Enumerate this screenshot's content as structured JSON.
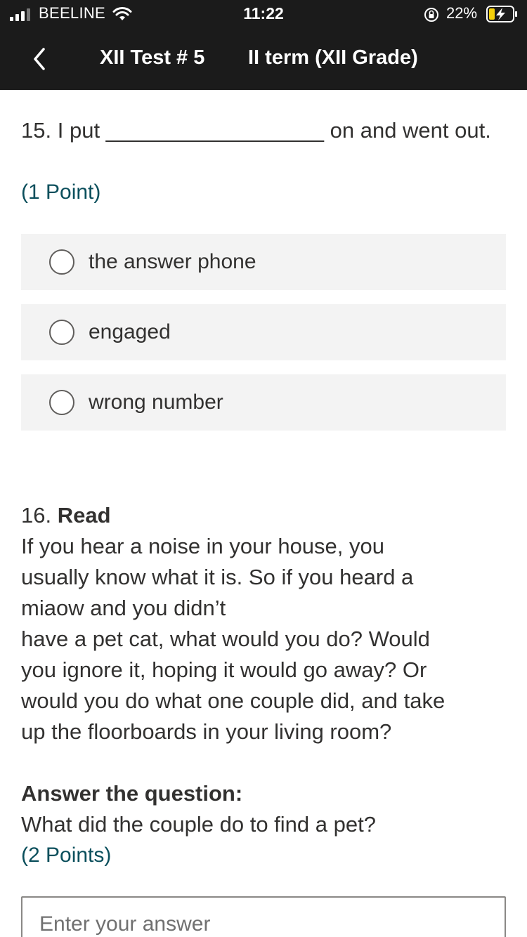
{
  "status_bar": {
    "carrier": "BEELINE",
    "time": "11:22",
    "battery_percent": "22%"
  },
  "nav": {
    "title": "XII Test # 5",
    "subtitle": "II term (XII Grade)"
  },
  "question15": {
    "number": "15.",
    "text": "I put __________________ on and went out.",
    "points": "(1 Point)",
    "options": [
      {
        "label": "the answer phone",
        "selected": false
      },
      {
        "label": "engaged",
        "selected": false
      },
      {
        "label": "wrong number",
        "selected": false
      }
    ]
  },
  "question16": {
    "number": "16.",
    "heading": "Read",
    "passage_lines": [
      "If you hear a noise in your house, you",
      "usually know what it is. So if you heard a",
      "miaow and you didn’t",
      "have a pet cat, what would you do? Would",
      "you ignore it, hoping it would go away? Or",
      "would you do what one couple did, and take",
      "up the floorboards in your living room?"
    ],
    "answer_label": "Answer the question:",
    "question": "What did the couple do to find a pet?",
    "points": "(2 Points)",
    "answer_value": "",
    "answer_placeholder": "Enter your answer"
  }
}
